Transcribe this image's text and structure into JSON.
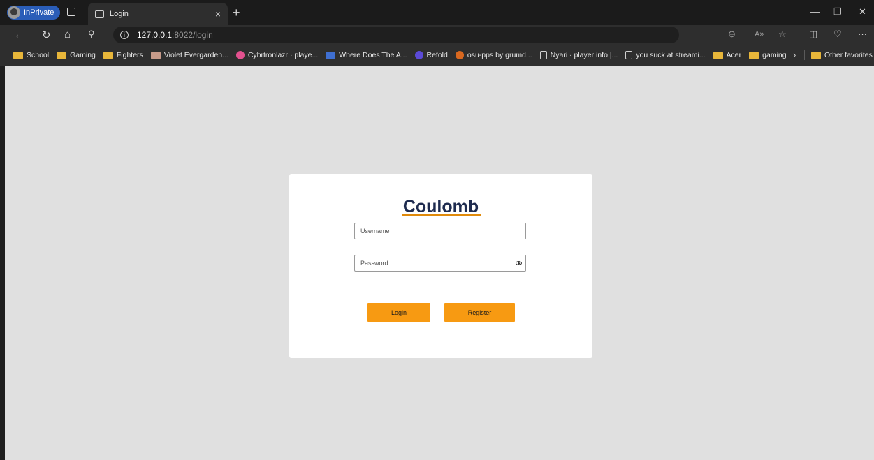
{
  "browser": {
    "inprivate_label": "InPrivate",
    "tab_title": "Login",
    "tab_close": "×",
    "new_tab": "+",
    "url_host": "127.0.0.1",
    "url_rest": ":8022/login"
  },
  "bookmarks": {
    "items": [
      {
        "label": "School",
        "icon": "folder-icon"
      },
      {
        "label": "Gaming",
        "icon": "folder-icon"
      },
      {
        "label": "Fighters",
        "icon": "folder-icon"
      },
      {
        "label": "Violet Evergarden...",
        "icon": "thumbnail-icon"
      },
      {
        "label": "Cybrtronlazr · playe...",
        "icon": "osu-icon"
      },
      {
        "label": "Where Does The A...",
        "icon": "bookmark-site-icon"
      },
      {
        "label": "Refold",
        "icon": "refold-icon"
      },
      {
        "label": "osu-pps by grumd...",
        "icon": "globe-icon"
      },
      {
        "label": "Nyari · player info |...",
        "icon": "page-icon"
      },
      {
        "label": "you suck at streami...",
        "icon": "page-icon"
      },
      {
        "label": "Acer",
        "icon": "folder-icon"
      },
      {
        "label": "gaming",
        "icon": "folder-icon"
      }
    ],
    "other_favorites": "Other favorites"
  },
  "login": {
    "brand": "Coulomb",
    "username_placeholder": "Username",
    "password_placeholder": "Password",
    "login_label": "Login",
    "register_label": "Register"
  },
  "colors": {
    "accent": "#f79a12",
    "brand_text": "#1e2b4f",
    "brand_underline": "#e08a0b",
    "page_bg": "#e0e0e0"
  }
}
